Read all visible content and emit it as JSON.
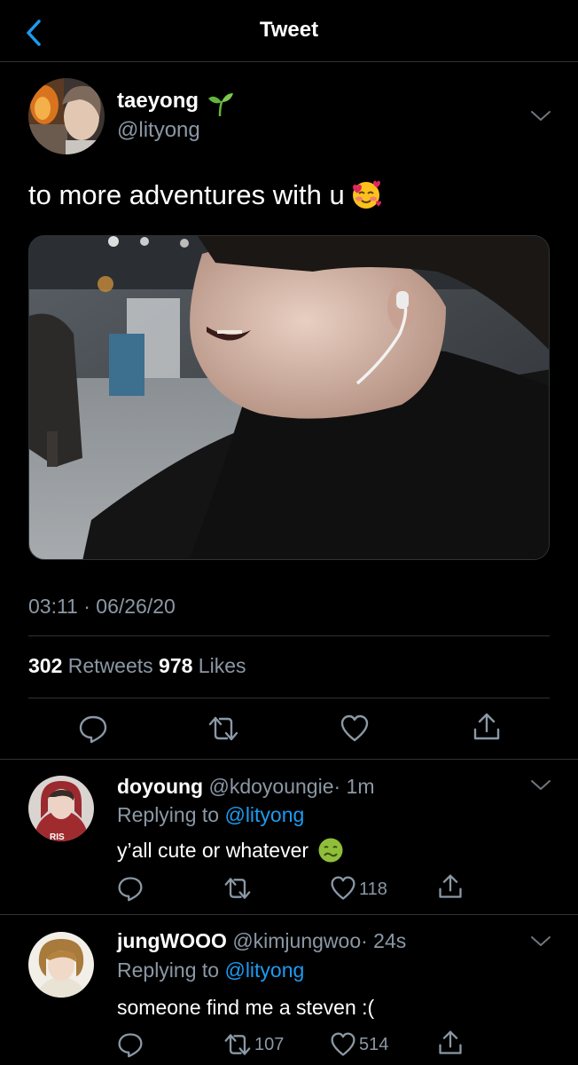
{
  "header": {
    "title": "Tweet"
  },
  "tweet": {
    "author_name": "taeyong",
    "author_handle": "@lityong",
    "text": "to more adventures with u",
    "time": "03:11 · 06/26/20",
    "retweet_count": "302",
    "retweet_label": "Retweets",
    "like_count": "978",
    "like_label": "Likes"
  },
  "replies": [
    {
      "name": "doyoung",
      "handle": "@kdoyoungie",
      "age": "· 1m",
      "replying_prefix": "Replying to ",
      "replying_mention": "@lityong",
      "text": "y’all cute or whatever",
      "retweets": "",
      "likes": "118"
    },
    {
      "name": "jungWOOO",
      "handle": "@kimjungwoo",
      "age": "· 24s",
      "replying_prefix": "Replying to ",
      "replying_mention": "@lityong",
      "text": "someone find me a steven :(",
      "retweets": "107",
      "likes": "514"
    }
  ],
  "colors": {
    "accent": "#1d9bf0",
    "muted": "#8b98a5",
    "divider": "#2f3336"
  },
  "icons": [
    "back-chevron-icon",
    "sprout-icon",
    "chevron-down-icon",
    "reply-icon",
    "retweet-icon",
    "heart-icon",
    "share-icon",
    "smiling-hearts-emoji",
    "nauseated-face-emoji"
  ]
}
